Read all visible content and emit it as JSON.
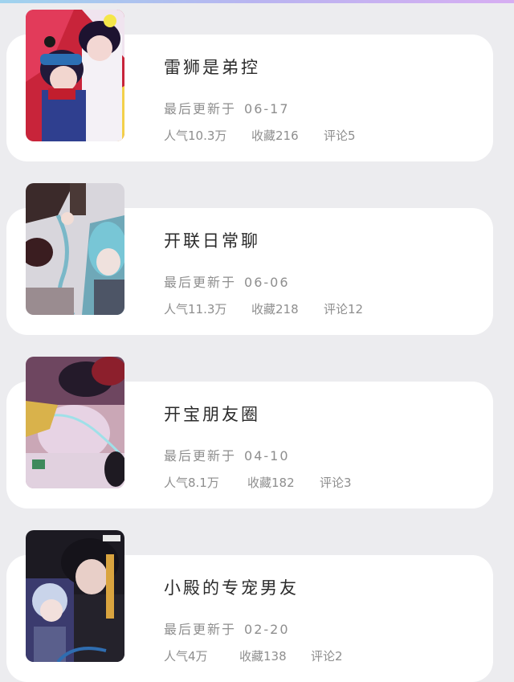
{
  "works": [
    {
      "title": "雷狮是弟控",
      "updated_label": "最后更新于",
      "updated_date": "06-17",
      "popularity": "人气10.3万",
      "favorites": "收藏216",
      "comments": "评论5"
    },
    {
      "title": "开联日常聊",
      "updated_label": "最后更新于",
      "updated_date": "06-06",
      "popularity": "人气11.3万",
      "favorites": "收藏218",
      "comments": "评论12"
    },
    {
      "title": "开宝朋友圈",
      "updated_label": "最后更新于",
      "updated_date": "04-10",
      "popularity": "人气8.1万",
      "favorites": "收藏182",
      "comments": "评论3"
    },
    {
      "title": "小殿的专宠男友",
      "updated_label": "最后更新于",
      "updated_date": "02-20",
      "popularity": "人气4万",
      "favorites": "收藏138",
      "comments": "评论2"
    }
  ]
}
